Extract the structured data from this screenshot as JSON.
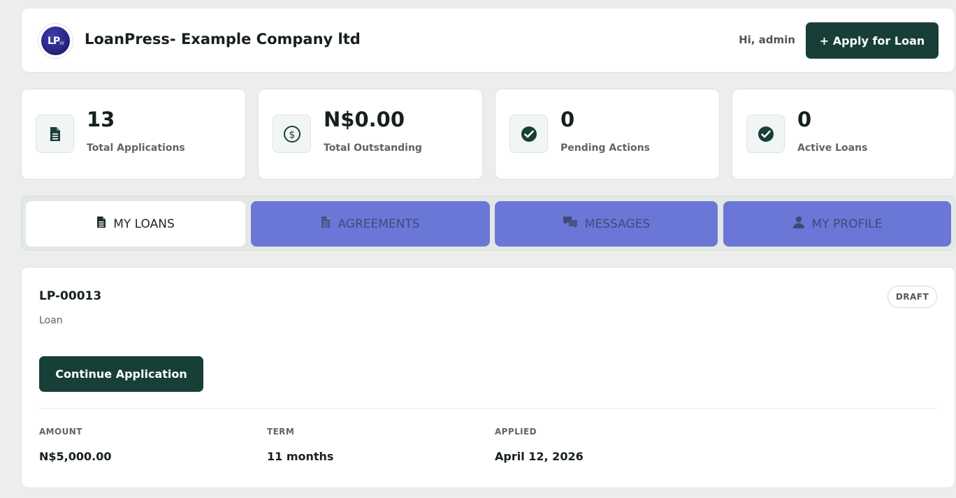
{
  "colors": {
    "primary": "#173f38",
    "tab_inactive": "#6b77d6",
    "background": "#eceeec"
  },
  "header": {
    "logo_text": "LP",
    "logo_suffix": "W",
    "company_name": "LoanPress- Example Company ltd",
    "greeting": "Hi, admin",
    "apply_button": "+ Apply for Loan"
  },
  "stats": [
    {
      "value": "13",
      "label": "Total Applications",
      "icon": "document-icon"
    },
    {
      "value": "N$0.00",
      "label": "Total Outstanding",
      "icon": "dollar-circle-icon"
    },
    {
      "value": "0",
      "label": "Pending Actions",
      "icon": "check-circle-icon"
    },
    {
      "value": "0",
      "label": "Active Loans",
      "icon": "check-circle-icon"
    }
  ],
  "tabs": [
    {
      "label": "MY LOANS",
      "icon": "document-icon",
      "active": true
    },
    {
      "label": "AGREEMENTS",
      "icon": "document-icon",
      "active": false
    },
    {
      "label": "MESSAGES",
      "icon": "chat-icon",
      "active": false
    },
    {
      "label": "MY PROFILE",
      "icon": "user-icon",
      "active": false
    }
  ],
  "loan": {
    "id": "LP-00013",
    "type": "Loan",
    "status": "DRAFT",
    "continue_button": "Continue Application",
    "amount_label": "AMOUNT",
    "amount": "N$5,000.00",
    "term_label": "TERM",
    "term": "11 months",
    "applied_label": "APPLIED",
    "applied": "April 12, 2026"
  }
}
